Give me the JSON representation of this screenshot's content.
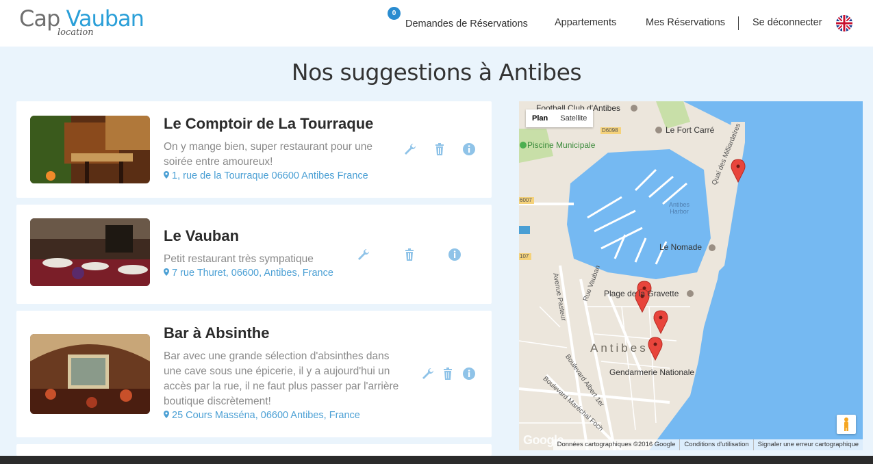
{
  "header": {
    "logo_main": "Cap",
    "logo_accent": "Vauban",
    "logo_sub": "location",
    "badge_count": "0",
    "nav": {
      "requests": "Demandes de Réservations",
      "apartments": "Appartements",
      "my_bookings": "Mes Réservations",
      "logout": "Se déconnecter"
    }
  },
  "page_title": "Nos suggestions à Antibes",
  "cards": [
    {
      "title": "Le Comptoir de La Tourraque",
      "desc": "On y mange bien, super restaurant pour une soirée entre amoureux!",
      "address": "1, rue de la Tourraque 06600 Antibes France"
    },
    {
      "title": "Le Vauban",
      "desc": "Petit restaurant très sympatique",
      "address": "7 rue Thuret, 06600, Antibes, France"
    },
    {
      "title": "Bar à Absinthe",
      "desc": "Bar avec une grande sélection d'absinthes dans une cave sous une épicerie, il y a aujourd'hui un accès par la rue, il ne faut plus passer par l'arrière boutique discrètement!",
      "address": "25 Cours Masséna, 06600 Antibes, France"
    }
  ],
  "map": {
    "toggle_plan": "Plan",
    "toggle_satellite": "Satellite",
    "labels": {
      "football": "Football Club d'Antibes",
      "fort": "Le Fort Carré",
      "piscine": "Piscine Municipale",
      "d6098": "D6098",
      "d6007": "6007",
      "d107": "107",
      "harbor": "Antibes Harbor",
      "quai": "Quai des Milliardaires",
      "nomade": "Le Nomade",
      "plage": "Plage de la Gravette",
      "antibes": "Antibes",
      "gendarmerie": "Gendarmerie Nationale",
      "avenue_pasteur": "Avenue Pasteur",
      "rue_vauban": "Rue Vauban",
      "bd_albert": "Boulevard Albert 1er",
      "bd_foch": "Boulevard Maréchal Foch"
    },
    "google": "Google",
    "footer": {
      "data": "Données cartographiques ©2016 Google",
      "terms": "Conditions d'utilisation",
      "report": "Signaler une erreur cartographique"
    }
  },
  "colors": {
    "accent": "#2a9fd8",
    "action_icon": "#8fc3e8",
    "water": "#75b9f2",
    "marker": "#e8453c"
  }
}
